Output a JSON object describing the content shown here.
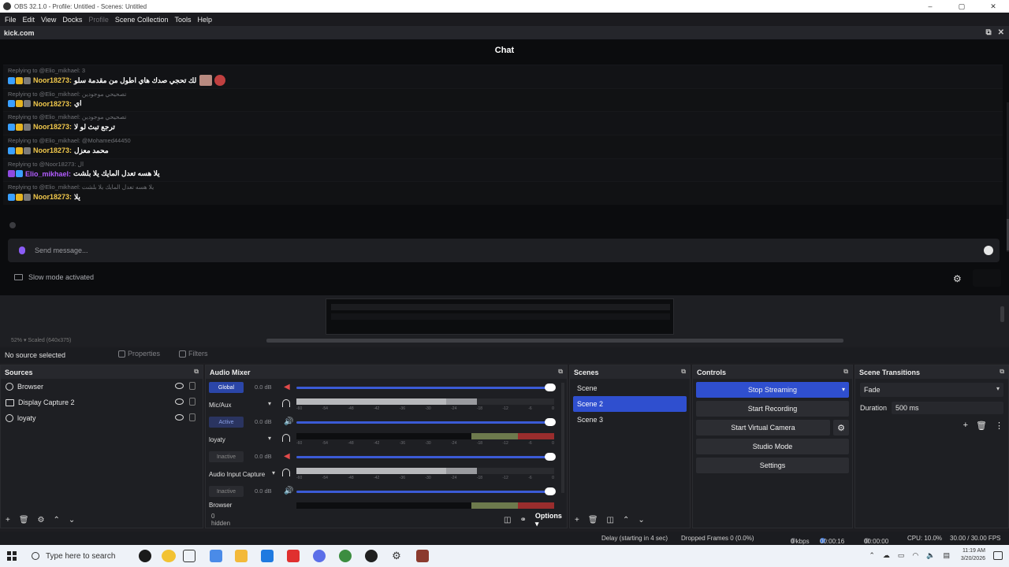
{
  "window": {
    "title": "OBS 32.1.0 - Profile: Untitled - Scenes: Untitled",
    "controls": [
      "–",
      "▢",
      "✕"
    ]
  },
  "menu": [
    "File",
    "Edit",
    "View",
    "Docks",
    "Profile",
    "Scene Collection",
    "Tools",
    "Help"
  ],
  "dock": {
    "title": "kick.com",
    "chat_title": "Chat",
    "messages": [
      {
        "reply": "Replying to @Elio_mikhael: 3",
        "user": "Noor18273:",
        "text": "لك تحجي صدك هاي اطول من مقدمة سلو",
        "color": "gold"
      },
      {
        "reply": "Replying to @Elio_mikhael: تصحيحي موجودين",
        "user": "Noor18273:",
        "text": "اي",
        "color": "gold"
      },
      {
        "reply": "Replying to @Elio_mikhael: تصحيحي موجودين",
        "user": "Noor18273:",
        "text": "ترجع تبث لو لا",
        "color": "gold"
      },
      {
        "reply": "Replying to @Elio_mikhael: @Mohamed44450",
        "user": "Noor18273:",
        "text": "محمد معزل",
        "color": "gold"
      },
      {
        "reply": "Replying to @Noor18273: ال",
        "user": "Elio_mikhael:",
        "text": "يلا هسه تعدل المايك يلا بلشت",
        "color": "purple"
      },
      {
        "reply": "Replying to @Elio_mikhael: يلا هسه تعدل المايك يلا بلشت",
        "user": "Noor18273:",
        "text": "يلا",
        "color": "gold"
      }
    ],
    "send_placeholder": "Send message...",
    "slow_mode": "Slow mode activated"
  },
  "preview": {
    "zoom": "52%",
    "scale": "Scaled (640x375)"
  },
  "source_toolbar": {
    "no_source": "No source selected",
    "properties": "Properties",
    "filters": "Filters"
  },
  "sources": {
    "title": "Sources",
    "items": [
      {
        "name": "Browser",
        "icon": "globe-icon"
      },
      {
        "name": "Display Capture 2",
        "icon": "monitor-icon"
      },
      {
        "name": "loyaty",
        "icon": "globe-icon"
      }
    ]
  },
  "mixer": {
    "title": "Audio Mixer",
    "tags": [
      "Global",
      "Active",
      "Inactive",
      "Inactive"
    ],
    "db": [
      "0.0 dB",
      "0.0 dB",
      "0.0 dB",
      "0.0 dB"
    ],
    "names": [
      "Mic/Aux",
      "loyaty",
      "Audio Input Capture",
      "Browser"
    ],
    "scale": [
      "-60",
      "-54",
      "-48",
      "-42",
      "-36",
      "-30",
      "-24",
      "-18",
      "-12",
      "-6",
      "0"
    ],
    "hidden": "0 hidden",
    "options": "Options"
  },
  "scenes": {
    "title": "Scenes",
    "items": [
      "Scene",
      "Scene 2",
      "Scene 3"
    ],
    "selected": 1
  },
  "controls": {
    "title": "Controls",
    "stop_streaming": "Stop Streaming",
    "start_recording": "Start Recording",
    "start_virtual_camera": "Start Virtual Camera",
    "studio_mode": "Studio Mode",
    "settings": "Settings"
  },
  "transitions": {
    "title": "Scene Transitions",
    "selected": "Fade",
    "duration_label": "Duration",
    "duration_value": "500 ms"
  },
  "status": {
    "delay": "Delay (starting in 4 sec)",
    "dropped": "Dropped Frames 0 (0.0%)",
    "kbps": "0 kbps",
    "stream_time": "00:00:16",
    "rec_time": "00:00:00",
    "cpu": "CPU: 10.0%",
    "fps": "30.00 / 30.00 FPS"
  },
  "taskbar": {
    "search_placeholder": "Type here to search",
    "time": "11:19 AM",
    "date": "3/20/2026"
  },
  "colors": {
    "accent": "#2f4fcf",
    "panel_bg": "#1e1f23",
    "chat_bg": "#0b0c0e"
  }
}
